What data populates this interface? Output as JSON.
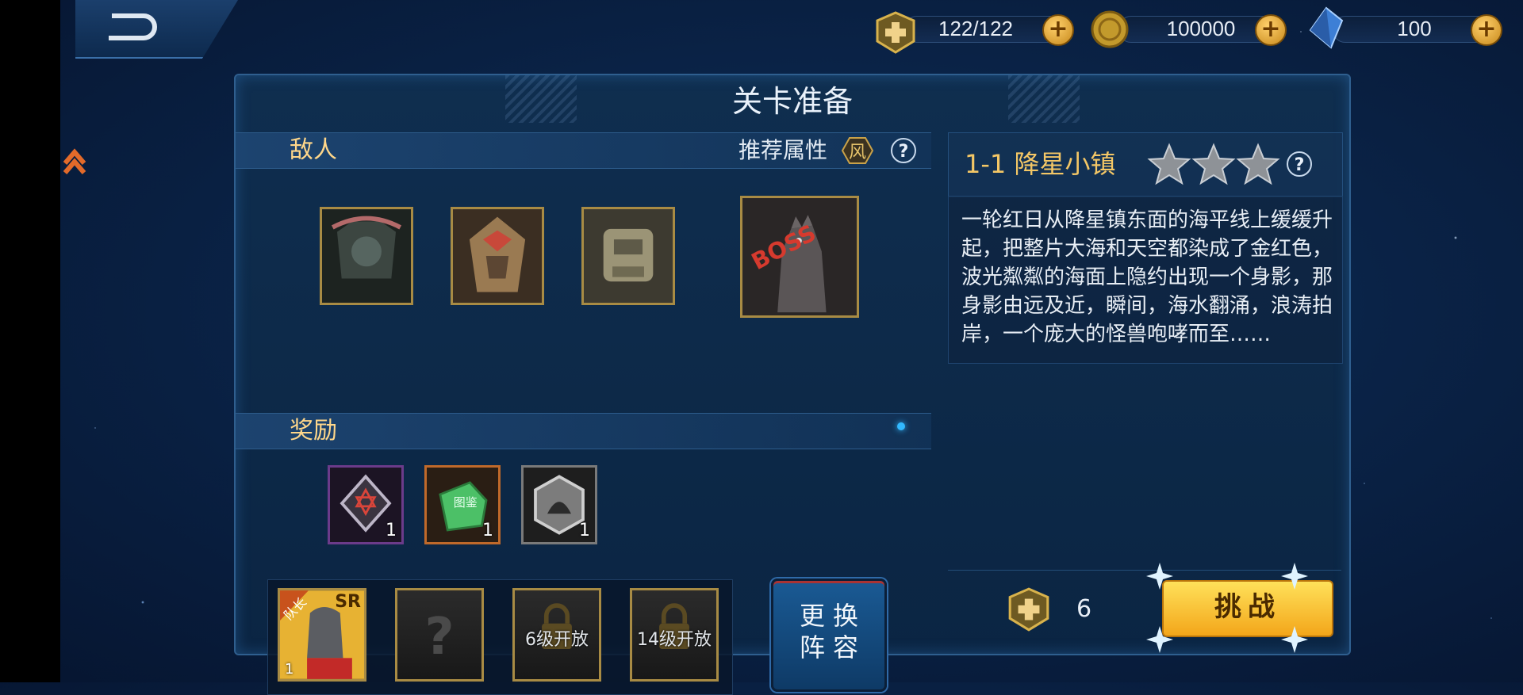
{
  "topbar": {
    "stamina": "122/122",
    "gold": "100000",
    "diamond": "100"
  },
  "panel": {
    "title": "关卡准备"
  },
  "enemies_section": {
    "label": "敌人",
    "recommend_label": "推荐属性",
    "recommend_attr": "风",
    "help": "?",
    "enemies": [
      {
        "name": "enemy-1"
      },
      {
        "name": "enemy-2"
      },
      {
        "name": "enemy-3"
      }
    ],
    "boss_tag": "BOSS"
  },
  "rewards_section": {
    "label": "奖励",
    "items": [
      {
        "count": "1",
        "border": "#6b3b8a"
      },
      {
        "count": "1",
        "border": "#c0692a",
        "text": "图鉴"
      },
      {
        "count": "1",
        "border": "#7a7a7a"
      }
    ]
  },
  "team": {
    "slot1": {
      "tag": "队长",
      "rarity": "SR",
      "level": "1"
    },
    "slot2": {
      "mark": "?"
    },
    "slot3": {
      "text": "6级开放"
    },
    "slot4": {
      "text": "14级开放"
    },
    "change_button": [
      "更换",
      "阵容"
    ]
  },
  "stage": {
    "title": "1-1 降星小镇",
    "stars": 3,
    "help": "?",
    "description": "一轮红日从降星镇东面的海平线上缓缓升起，把整片大海和天空都染成了金红色，波光粼粼的海面上隐约出现一个身影，那身影由远及近，瞬间，海水翻涌，浪涛拍岸，一个庞大的怪兽咆哮而至……",
    "cost": "6",
    "challenge": "挑战"
  },
  "colors": {
    "accent_gold": "#f4c766",
    "frame_gold": "#a88b44"
  }
}
